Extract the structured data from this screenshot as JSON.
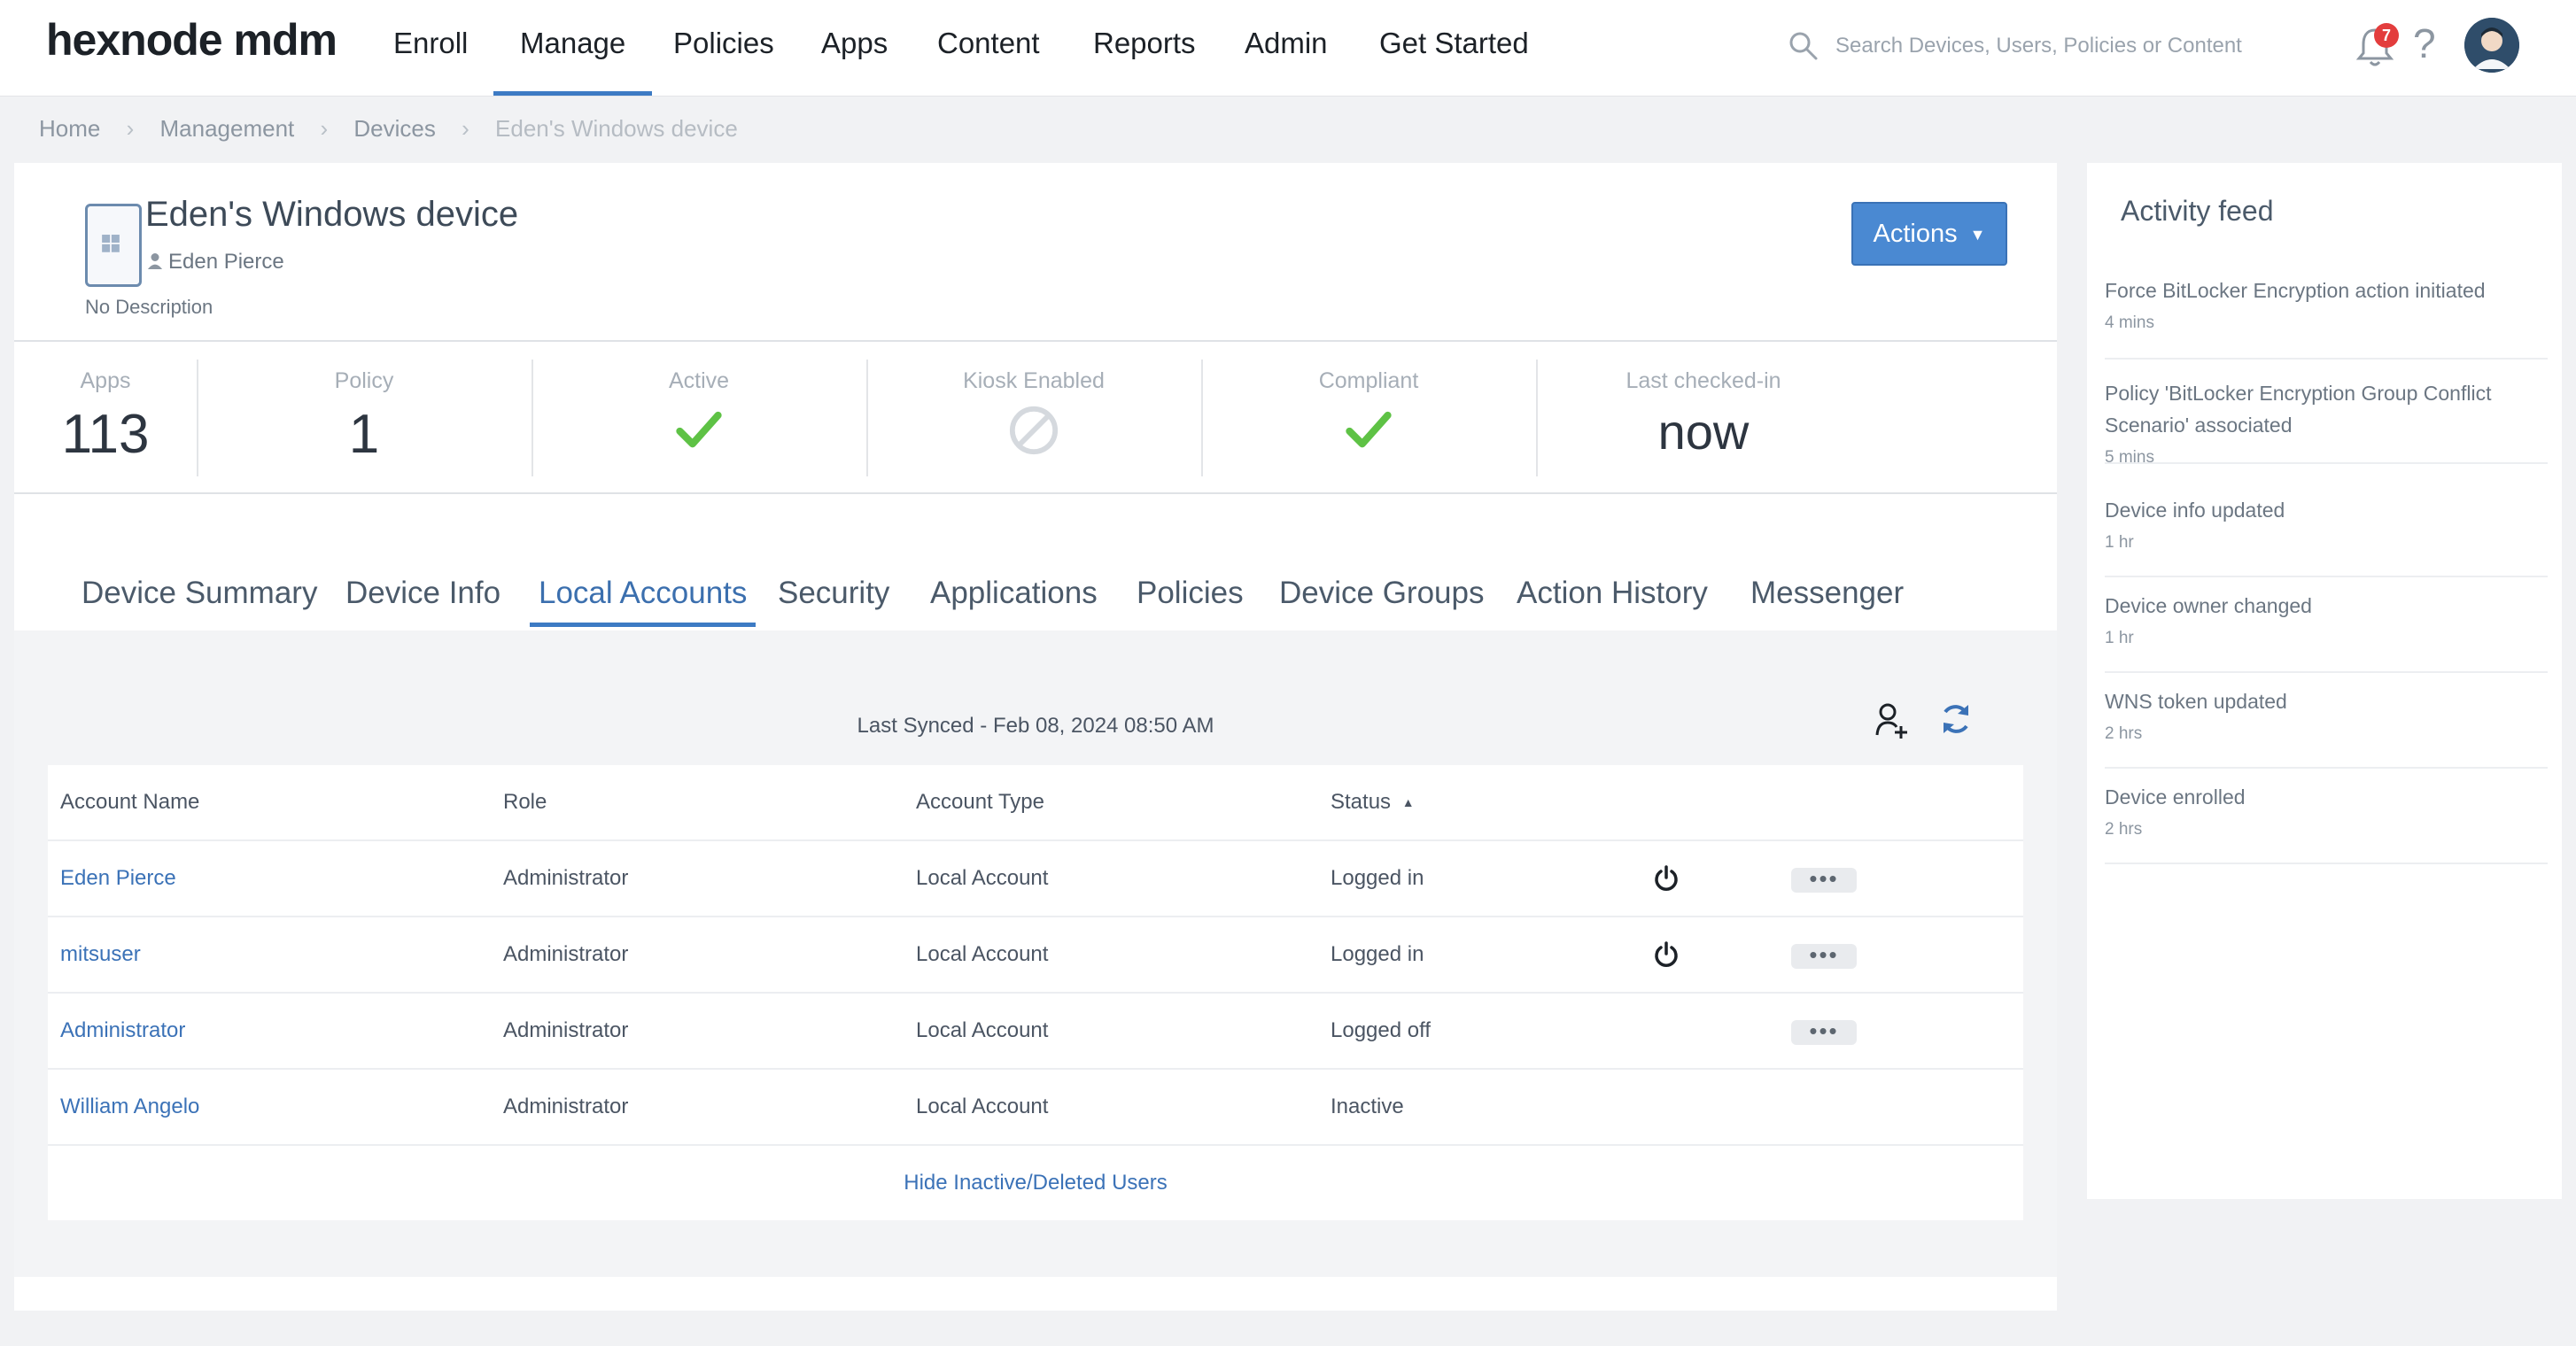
{
  "brand": "hexnode mdm",
  "nav": {
    "items": [
      "Enroll",
      "Manage",
      "Policies",
      "Apps",
      "Content",
      "Reports",
      "Admin",
      "Get Started"
    ],
    "active": "Manage"
  },
  "search": {
    "placeholder": "Search Devices, Users, Policies or Content"
  },
  "notifications": {
    "count": "7"
  },
  "help_label": "?",
  "breadcrumb": [
    "Home",
    "Management",
    "Devices",
    "Eden's Windows device"
  ],
  "device": {
    "title": "Eden's Windows device",
    "owner": "Eden Pierce",
    "description": "No Description"
  },
  "actions_label": "Actions",
  "stats": [
    {
      "label": "Apps",
      "value": "113"
    },
    {
      "label": "Policy",
      "value": "1"
    },
    {
      "label": "Active",
      "icon": "check-icon"
    },
    {
      "label": "Kiosk Enabled",
      "icon": "disabled-icon"
    },
    {
      "label": "Compliant",
      "icon": "check-icon"
    },
    {
      "label": "Last checked-in",
      "value": "now"
    }
  ],
  "tabs": [
    "Device Summary",
    "Device Info",
    "Local Accounts",
    "Security",
    "Applications",
    "Policies",
    "Device Groups",
    "Action History",
    "Messenger"
  ],
  "active_tab": "Local Accounts",
  "local_accounts": {
    "last_synced": "Last Synced - Feb 08, 2024 08:50 AM",
    "columns": [
      "Account Name",
      "Role",
      "Account Type",
      "Status"
    ],
    "sort_indicator": "▲",
    "rows": [
      {
        "name": "Eden Pierce",
        "role": "Administrator",
        "type": "Local Account",
        "status": "Logged in"
      },
      {
        "name": "mitsuser",
        "role": "Administrator",
        "type": "Local Account",
        "status": "Logged in"
      },
      {
        "name": "Administrator",
        "role": "Administrator",
        "type": "Local Account",
        "status": "Logged off"
      },
      {
        "name": "William Angelo",
        "role": "Administrator",
        "type": "Local Account",
        "status": "Inactive"
      }
    ],
    "more_label": "•••",
    "hide_link": "Hide Inactive/Deleted Users"
  },
  "activity_feed": {
    "title": "Activity feed",
    "items": [
      {
        "text": "Force BitLocker Encryption action initiated",
        "time": "4 mins"
      },
      {
        "text": "Policy 'BitLocker Encryption Group Conflict Scenario' associated",
        "time": "5 mins"
      },
      {
        "text": "Device info updated",
        "time": "1 hr"
      },
      {
        "text": "Device owner changed",
        "time": "1 hr"
      },
      {
        "text": "WNS token updated",
        "time": "2 hrs"
      },
      {
        "text": "Device enrolled",
        "time": "2 hrs"
      }
    ]
  },
  "colors": {
    "accent": "#3d7bc4",
    "check": "#5ec245",
    "badge": "#e33d3d"
  }
}
